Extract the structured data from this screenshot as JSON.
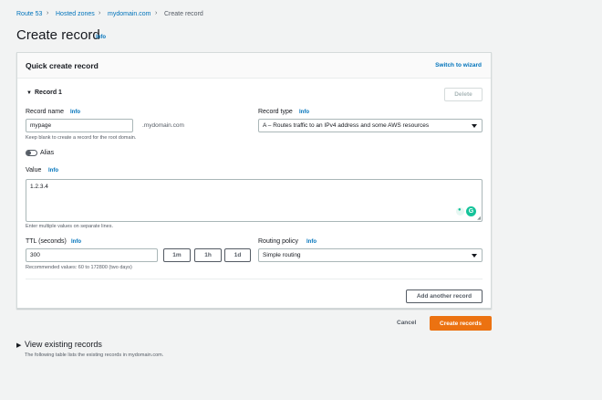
{
  "breadcrumb": {
    "items": [
      "Route 53",
      "Hosted zones",
      "mydomain.com"
    ],
    "current": "Create record"
  },
  "page": {
    "title": "Create record",
    "info": "Info"
  },
  "card": {
    "title": "Quick create record",
    "switch_link": "Switch to wizard",
    "record_label": "Record 1",
    "delete_label": "Delete"
  },
  "record_name": {
    "label": "Record name",
    "info": "Info",
    "value": "mypage",
    "suffix": ".mydomain.com",
    "hint": "Keep blank to create a record for the root domain."
  },
  "record_type": {
    "label": "Record type",
    "info": "Info",
    "selected": "A – Routes traffic to an IPv4 address and some AWS resources"
  },
  "alias": {
    "label": "Alias",
    "enabled": false
  },
  "value_field": {
    "label": "Value",
    "info": "Info",
    "value": "1.2.3.4",
    "hint": "Enter multiple values on separate lines."
  },
  "ttl": {
    "label": "TTL (seconds)",
    "info": "Info",
    "value": "300",
    "presets": [
      "1m",
      "1h",
      "1d"
    ],
    "hint": "Recommended values: 60 to 172800 (two days)"
  },
  "routing_policy": {
    "label": "Routing policy",
    "info": "Info",
    "selected": "Simple routing"
  },
  "actions": {
    "add_another": "Add another record",
    "cancel": "Cancel",
    "create": "Create records"
  },
  "existing": {
    "title": "View existing records",
    "description": "The following table lists the existing records in mydomain.com."
  },
  "colors": {
    "link": "#0073bb",
    "primary": "#ec7211",
    "grammarly": "#15c39a"
  }
}
